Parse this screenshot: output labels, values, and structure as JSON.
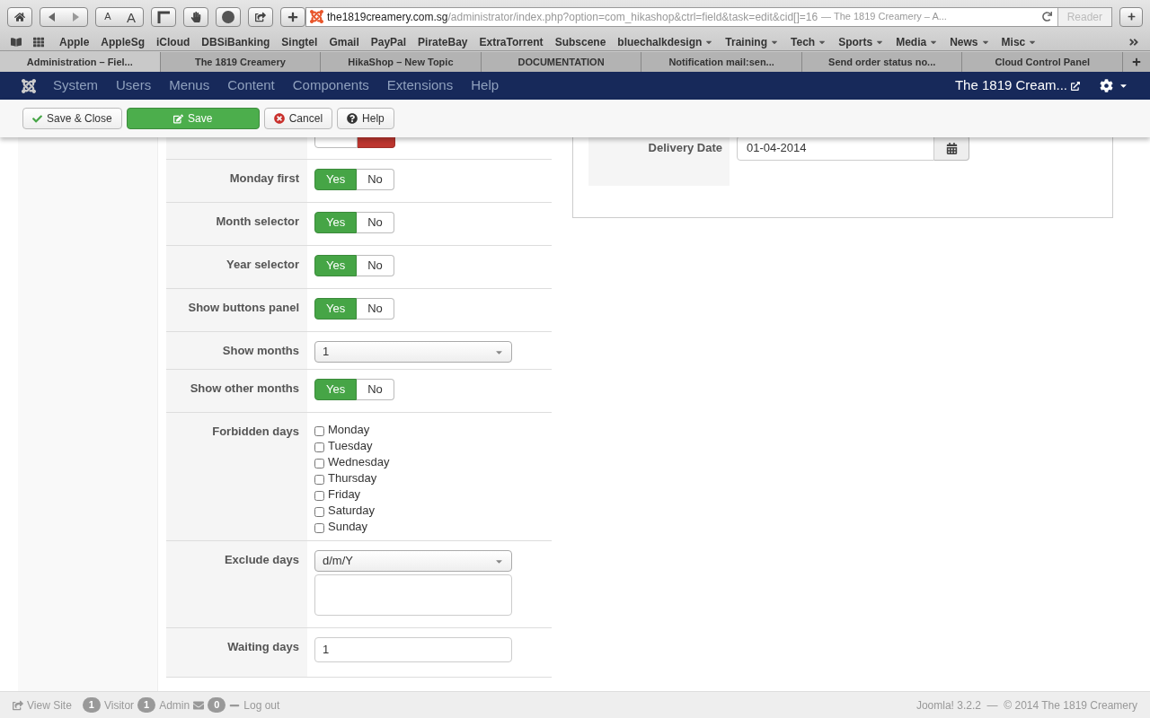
{
  "browser": {
    "text_size_buttons": [
      "A",
      "A"
    ],
    "url_host": "the1819creamery.com.sg",
    "url_path": "/administrator/index.php?option=com_hikashop&ctrl=field&task=edit&cid[]=16",
    "page_title": "— The 1819 Creamery – A...",
    "reader": "Reader",
    "bookmarks": [
      {
        "label": "Apple",
        "menu": false
      },
      {
        "label": "AppleSg",
        "menu": false
      },
      {
        "label": "iCloud",
        "menu": false
      },
      {
        "label": "DBSiBanking",
        "menu": false
      },
      {
        "label": "Singtel",
        "menu": false
      },
      {
        "label": "Gmail",
        "menu": false
      },
      {
        "label": "PayPal",
        "menu": false
      },
      {
        "label": "PirateBay",
        "menu": false
      },
      {
        "label": "ExtraTorrent",
        "menu": false
      },
      {
        "label": "Subscene",
        "menu": false
      },
      {
        "label": "bluechalkdesign",
        "menu": true
      },
      {
        "label": "Training",
        "menu": true
      },
      {
        "label": "Tech",
        "menu": true
      },
      {
        "label": "Sports",
        "menu": true
      },
      {
        "label": "Media",
        "menu": true
      },
      {
        "label": "News",
        "menu": true
      },
      {
        "label": "Misc",
        "menu": true
      }
    ],
    "tabs": [
      {
        "label": "Administration – Fiel...",
        "selected": true
      },
      {
        "label": "The 1819 Creamery",
        "selected": false
      },
      {
        "label": "HikaShop – New Topic",
        "selected": false
      },
      {
        "label": "DOCUMENTATION",
        "selected": false
      },
      {
        "label": "Notification mail:sen...",
        "selected": false
      },
      {
        "label": "Send order status no...",
        "selected": false
      },
      {
        "label": "Cloud Control Panel",
        "selected": false
      }
    ]
  },
  "navbar": {
    "menu": [
      "System",
      "Users",
      "Menus",
      "Content",
      "Components",
      "Extensions",
      "Help"
    ],
    "site_link": "The 1819 Cream..."
  },
  "toolbar": [
    {
      "label": "Save & Close",
      "kind": "save-close"
    },
    {
      "label": "Save",
      "kind": "save"
    },
    {
      "label": "Cancel",
      "kind": "cancel"
    },
    {
      "label": "Help",
      "kind": "help"
    }
  ],
  "partial_toggle": {
    "yes_selected": false
  },
  "rows": [
    {
      "label": "Monday first",
      "kind": "toggle",
      "options": [
        {
          "label": "Yes",
          "selected": true
        },
        {
          "label": "No",
          "selected": false
        }
      ]
    },
    {
      "label": "Month selector",
      "kind": "toggle",
      "options": [
        {
          "label": "Yes",
          "selected": true
        },
        {
          "label": "No",
          "selected": false
        }
      ]
    },
    {
      "label": "Year selector",
      "kind": "toggle",
      "options": [
        {
          "label": "Yes",
          "selected": true
        },
        {
          "label": "No",
          "selected": false
        }
      ]
    },
    {
      "label": "Show buttons panel",
      "kind": "toggle",
      "options": [
        {
          "label": "Yes",
          "selected": true
        },
        {
          "label": "No",
          "selected": false
        }
      ]
    },
    {
      "label": "Show months",
      "kind": "select",
      "value": "1"
    },
    {
      "label": "Show other months",
      "kind": "toggle",
      "options": [
        {
          "label": "Yes",
          "selected": true
        },
        {
          "label": "No",
          "selected": false
        }
      ]
    },
    {
      "label": "Forbidden days",
      "kind": "checkboxes",
      "items": [
        {
          "label": "Monday",
          "checked": false
        },
        {
          "label": "Tuesday",
          "checked": false
        },
        {
          "label": "Wednesday",
          "checked": false
        },
        {
          "label": "Thursday",
          "checked": false
        },
        {
          "label": "Friday",
          "checked": false
        },
        {
          "label": "Saturday",
          "checked": false
        },
        {
          "label": "Sunday",
          "checked": false
        }
      ]
    },
    {
      "label": "Exclude days",
      "kind": "select-textarea",
      "value": "d/m/Y"
    },
    {
      "label": "Waiting days",
      "kind": "input",
      "value": "1"
    }
  ],
  "preview": {
    "label": "Delivery Date",
    "value": "01-04-2014"
  },
  "status_bar": {
    "view_site": "View Site",
    "visitors_count": "1",
    "visitors": "Visitor",
    "admins_count": "1",
    "admins": "Admin",
    "messages_count": "0",
    "logout": "Log out",
    "footer": "Joomla! 3.2.2  —  © 2014 The 1819 Creamery"
  }
}
